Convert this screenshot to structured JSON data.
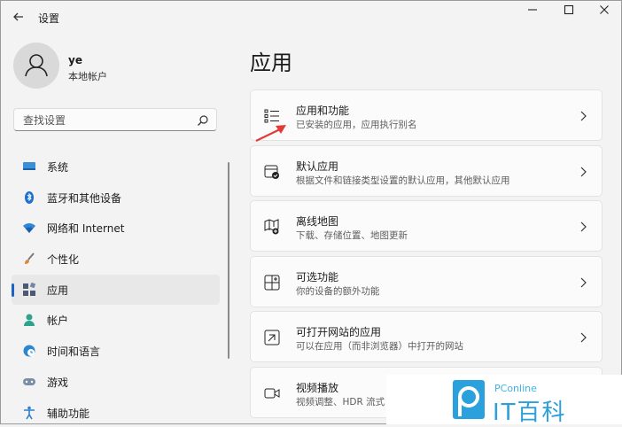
{
  "window": {
    "title": "设置",
    "back_icon": "back-arrow-icon",
    "controls": {
      "minimize": "minimize-icon",
      "maximize": "maximize-icon",
      "close": "close-icon"
    }
  },
  "user": {
    "name": "ye",
    "account_type": "本地帐户",
    "avatar_icon": "user-avatar-icon"
  },
  "search": {
    "placeholder": "查找设置",
    "icon": "search-icon"
  },
  "sidebar": {
    "items": [
      {
        "label": "系统",
        "icon": "system-icon",
        "color": "#3a8fd6",
        "active": false
      },
      {
        "label": "蓝牙和其他设备",
        "icon": "bluetooth-icon",
        "color": "#1e6fd0",
        "active": false
      },
      {
        "label": "网络和 Internet",
        "icon": "wifi-icon",
        "color": "#2d86d6",
        "active": false
      },
      {
        "label": "个性化",
        "icon": "brush-icon",
        "color": "#d88a3c",
        "active": false
      },
      {
        "label": "应用",
        "icon": "apps-icon",
        "color": "#4b5a72",
        "active": true
      },
      {
        "label": "帐户",
        "icon": "account-icon",
        "color": "#2ca38b",
        "active": false
      },
      {
        "label": "时间和语言",
        "icon": "clock-globe-icon",
        "color": "#2a86cf",
        "active": false
      },
      {
        "label": "游戏",
        "icon": "gamepad-icon",
        "color": "#7a8fa6",
        "active": false
      },
      {
        "label": "辅助功能",
        "icon": "accessibility-icon",
        "color": "#2a7fd0",
        "active": false
      }
    ]
  },
  "main": {
    "title": "应用",
    "cards": [
      {
        "title": "应用和功能",
        "desc": "已安装的应用，应用执行别名",
        "icon": "apps-list-icon"
      },
      {
        "title": "默认应用",
        "desc": "根据文件和链接类型设置的默认应用，其他默认应用",
        "icon": "default-apps-icon"
      },
      {
        "title": "离线地图",
        "desc": "下载、存储位置、地图更新",
        "icon": "offline-map-icon"
      },
      {
        "title": "可选功能",
        "desc": "你的设备的额外功能",
        "icon": "optional-features-icon"
      },
      {
        "title": "可打开网站的应用",
        "desc": "可以在应用（而非浏览器）中打开的网站",
        "icon": "open-website-icon"
      },
      {
        "title": "视频播放",
        "desc": "视频调整、HDR 流式",
        "icon": "video-playback-icon"
      }
    ]
  },
  "annotation": {
    "color": "#e23b36"
  },
  "watermark": {
    "brand": "PConline",
    "text": "IT百科",
    "color": "#2aa0dc"
  }
}
